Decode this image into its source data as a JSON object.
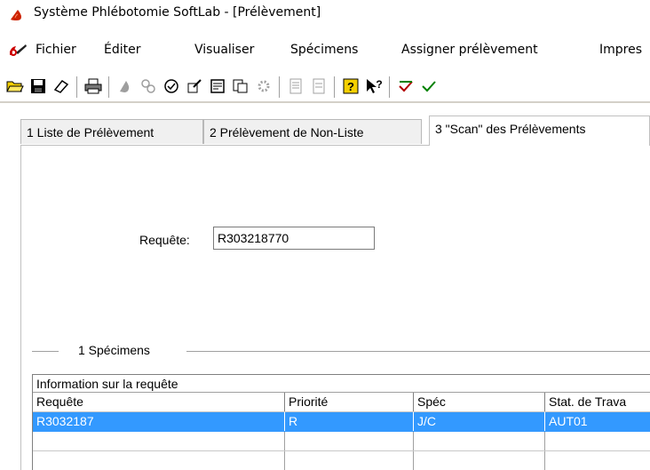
{
  "window": {
    "title": "Système Phlébotomie SoftLab - [Prélèvement]"
  },
  "menubar": {
    "items": [
      "Fichier",
      "Éditer",
      "Visualiser",
      "Spécimens",
      "Assigner prélèvement",
      "Impres"
    ]
  },
  "toolbar": {
    "buttons": [
      "open-folder-icon",
      "save-disk-icon",
      "eraser-icon",
      "print-icon",
      "collect-drop-icon",
      "specimen-icon",
      "badge-icon",
      "edit-icon",
      "note-icon",
      "copy-icon",
      "settings-icon",
      "document-icon",
      "list-icon",
      "help-icon",
      "context-help-icon",
      "check-icon",
      "extra-icon"
    ]
  },
  "tabs": [
    {
      "label": "1 Liste de Prélèvement",
      "active": false
    },
    {
      "label": "2 Prélèvement de Non-Liste",
      "active": false
    },
    {
      "label": "3 \"Scan\" des Prélèvements",
      "active": true
    }
  ],
  "form": {
    "requete_label": "Requête:",
    "requete_value": "R303218770"
  },
  "specimens": {
    "group_title": "1  Spécimens",
    "band_label": "Information sur la requête",
    "columns": [
      "Requête",
      "Priorité",
      "Spéc",
      "Stat. de Trava"
    ],
    "rows": [
      [
        "R3032187",
        "R",
        "J/C",
        "AUT01"
      ],
      [
        "",
        "",
        "",
        ""
      ],
      [
        "",
        "",
        "",
        ""
      ]
    ]
  },
  "colors": {
    "selection": "#3399ff",
    "app_icon_red": "#cc2200"
  }
}
